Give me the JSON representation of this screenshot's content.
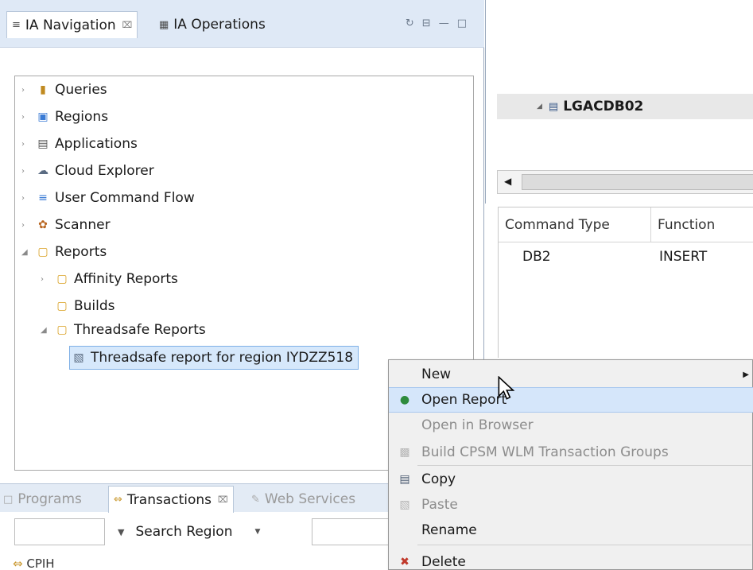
{
  "nav_panel": {
    "tabs": [
      {
        "label": "IA Navigation",
        "icon": "list-icon",
        "closable": true,
        "active": true
      },
      {
        "label": "IA Operations",
        "icon": "operations-icon",
        "closable": false,
        "active": false
      }
    ],
    "tools": [
      "sync-icon",
      "collapse-icon",
      "minimize-icon",
      "maximize-icon"
    ],
    "tree": [
      {
        "label": "Queries",
        "icon": "queries-icon",
        "expanded": false
      },
      {
        "label": "Regions",
        "icon": "regions-icon",
        "expanded": false
      },
      {
        "label": "Applications",
        "icon": "applications-icon",
        "expanded": false
      },
      {
        "label": "Cloud Explorer",
        "icon": "cloud-icon",
        "expanded": false
      },
      {
        "label": "User Command Flow",
        "icon": "command-flow-icon",
        "expanded": false
      },
      {
        "label": "Scanner",
        "icon": "scanner-icon",
        "expanded": false
      },
      {
        "label": "Reports",
        "icon": "folder-icon",
        "expanded": true
      },
      {
        "label": "Affinity Reports",
        "icon": "folder-icon",
        "expanded": false
      },
      {
        "label": "Builds",
        "icon": "folder-icon",
        "expanded": false
      },
      {
        "label": "Threadsafe Reports",
        "icon": "folder-icon",
        "expanded": true
      },
      {
        "label": "Threadsafe report for region IYDZZ518",
        "icon": "report-icon",
        "selected": true
      }
    ]
  },
  "bottom_panel": {
    "tabs": [
      {
        "label": "Programs",
        "icon": "program-icon"
      },
      {
        "label": "Transactions",
        "icon": "transactions-icon",
        "active": true
      },
      {
        "label": "Web Services",
        "icon": "webservices-icon"
      }
    ],
    "search_label": "Search Region",
    "first_row": "CPIH"
  },
  "right_panel": {
    "tree_node": "LGACDB02",
    "table": {
      "headers": [
        "Command Type",
        "Function"
      ],
      "rows": [
        [
          "DB2",
          "INSERT"
        ]
      ]
    }
  },
  "context_menu": {
    "items": [
      {
        "label": "New",
        "icon": "",
        "enabled": true,
        "submenu": true
      },
      {
        "label": "Open Report",
        "icon": "play-icon",
        "enabled": true,
        "highlighted": true
      },
      {
        "label": "Open in Browser",
        "icon": "",
        "enabled": false
      },
      {
        "label": "Build CPSM WLM Transaction Groups",
        "icon": "build-icon",
        "enabled": false
      },
      {
        "label": "Copy",
        "icon": "copy-icon",
        "enabled": true
      },
      {
        "label": "Paste",
        "icon": "paste-icon",
        "enabled": false
      },
      {
        "label": "Rename",
        "icon": "",
        "enabled": true
      },
      {
        "label": "Delete",
        "icon": "delete-icon",
        "enabled": true
      }
    ]
  },
  "colors": {
    "tab_bar": "#dfe9f6",
    "selection": "#d6e8fb",
    "menu_highlight": "#d5e6fa",
    "delete_red": "#c0392b",
    "play_green": "#2e8b3c"
  }
}
